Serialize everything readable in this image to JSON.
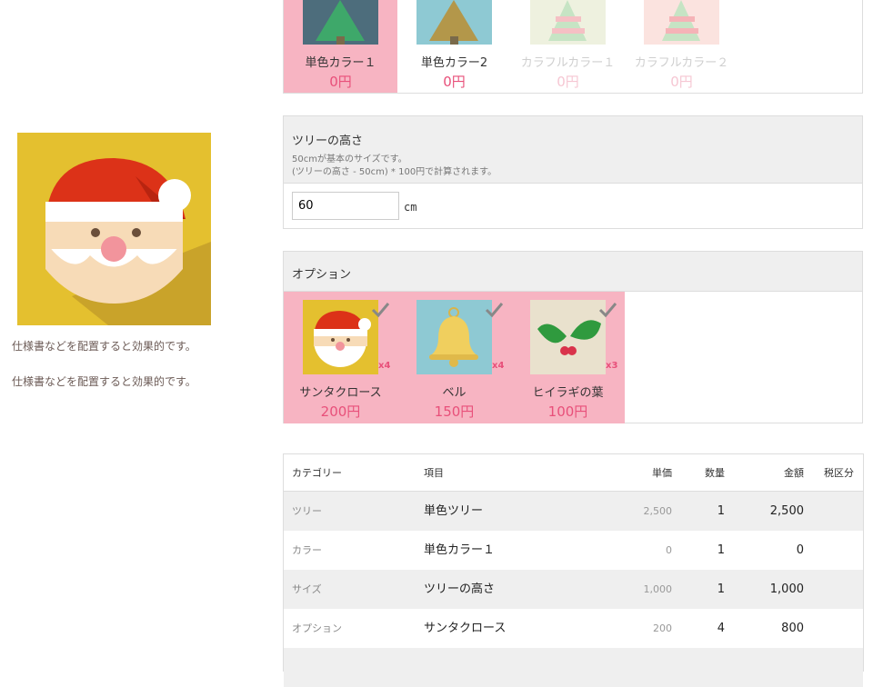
{
  "colors": [
    {
      "name": "単色カラー１",
      "price": "0円",
      "active": true
    },
    {
      "name": "単色カラー2",
      "price": "0円",
      "active": false
    },
    {
      "name": "カラフルカラー１",
      "price": "0円",
      "active": false
    },
    {
      "name": "カラフルカラー２",
      "price": "0円",
      "active": false
    }
  ],
  "side": {
    "note1": "仕様書などを配置すると効果的です。",
    "note2": "仕様書などを配置すると効果的です。"
  },
  "height": {
    "title": "ツリーの高さ",
    "desc1": "50cmが基本のサイズです。",
    "desc2": "(ツリーの高さ - 50cm) * 100円で計算されます。",
    "value": "60",
    "unit": "cm"
  },
  "options": {
    "title": "オプション",
    "items": [
      {
        "name": "サンタクロース",
        "price": "200円",
        "qty": "x4",
        "icon": "santa-icon"
      },
      {
        "name": "ベル",
        "price": "150円",
        "qty": "x4",
        "icon": "bell-icon"
      },
      {
        "name": "ヒイラギの葉",
        "price": "100円",
        "qty": "x3",
        "icon": "holly-icon"
      }
    ]
  },
  "table": {
    "headers": {
      "category": "カテゴリー",
      "item": "項目",
      "unit_price": "単価",
      "qty": "数量",
      "amount": "金額",
      "tax": "税区分"
    },
    "rows": [
      {
        "category": "ツリー",
        "item": "単色ツリー",
        "unit_price": "2,500",
        "qty": "1",
        "amount": "2,500",
        "tax": ""
      },
      {
        "category": "カラー",
        "item": "単色カラー１",
        "unit_price": "0",
        "qty": "1",
        "amount": "0",
        "tax": ""
      },
      {
        "category": "サイズ",
        "item": "ツリーの高さ",
        "unit_price": "1,000",
        "qty": "1",
        "amount": "1,000",
        "tax": ""
      },
      {
        "category": "オプション",
        "item": "サンタクロース",
        "unit_price": "200",
        "qty": "4",
        "amount": "800",
        "tax": ""
      }
    ]
  },
  "theme": {
    "selected_bg": "#f7b4c2",
    "price_color": "#e8507a",
    "header_bg": "#efefef"
  }
}
